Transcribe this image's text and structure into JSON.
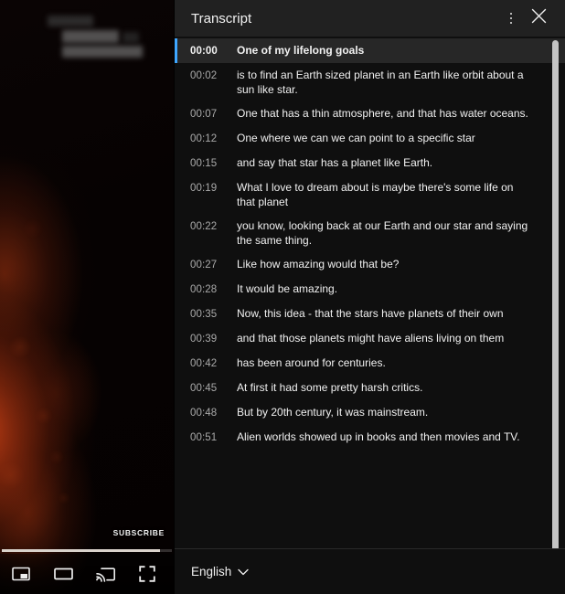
{
  "player": {
    "subscribe_label": "SUBSCRIBE",
    "progress_percent": 93,
    "controls": [
      {
        "name": "miniplayer-icon",
        "label": "Miniplayer"
      },
      {
        "name": "theater-mode-icon",
        "label": "Theater mode"
      },
      {
        "name": "cast-icon",
        "label": "Play on TV"
      },
      {
        "name": "fullscreen-icon",
        "label": "Full screen"
      }
    ]
  },
  "transcript": {
    "title": "Transcript",
    "more_menu_icon": "kebab-menu-icon",
    "close_icon": "close-icon",
    "active_index": 0,
    "segments": [
      {
        "time": "00:00",
        "text": "One of my lifelong goals"
      },
      {
        "time": "00:02",
        "text": "is to find an Earth sized planet in an Earth like orbit about a sun like star."
      },
      {
        "time": "00:07",
        "text": "One that has a thin atmosphere, and that has water oceans."
      },
      {
        "time": "00:12",
        "text": "One where we can we can point to a specific star"
      },
      {
        "time": "00:15",
        "text": "and say that star has a planet like Earth."
      },
      {
        "time": "00:19",
        "text": "What I love to dream about is maybe there's some life on that planet"
      },
      {
        "time": "00:22",
        "text": "you know, looking back at our Earth and our star and saying the same thing."
      },
      {
        "time": "00:27",
        "text": "Like how amazing would that be?"
      },
      {
        "time": "00:28",
        "text": "It would be amazing."
      },
      {
        "time": "00:35",
        "text": "Now, this idea - that the stars have planets of their own"
      },
      {
        "time": "00:39",
        "text": "and that those planets might have aliens living on them"
      },
      {
        "time": "00:42",
        "text": "has been around for centuries."
      },
      {
        "time": "00:45",
        "text": "At first it had some pretty harsh critics."
      },
      {
        "time": "00:48",
        "text": "But by 20th century, it was mainstream."
      },
      {
        "time": "00:51",
        "text": "Alien worlds showed up in books and then movies and TV."
      }
    ],
    "footer": {
      "language": "English",
      "chevron_icon": "chevron-down-icon"
    }
  },
  "colors": {
    "accent": "#3ea6ff",
    "panel_bg": "#0f0f0f",
    "header_bg": "#212121",
    "active_row_bg": "#272727",
    "text_primary": "#f1f1f1",
    "text_secondary": "#aaaaaa",
    "scrollbar": "#c4c4c4"
  }
}
